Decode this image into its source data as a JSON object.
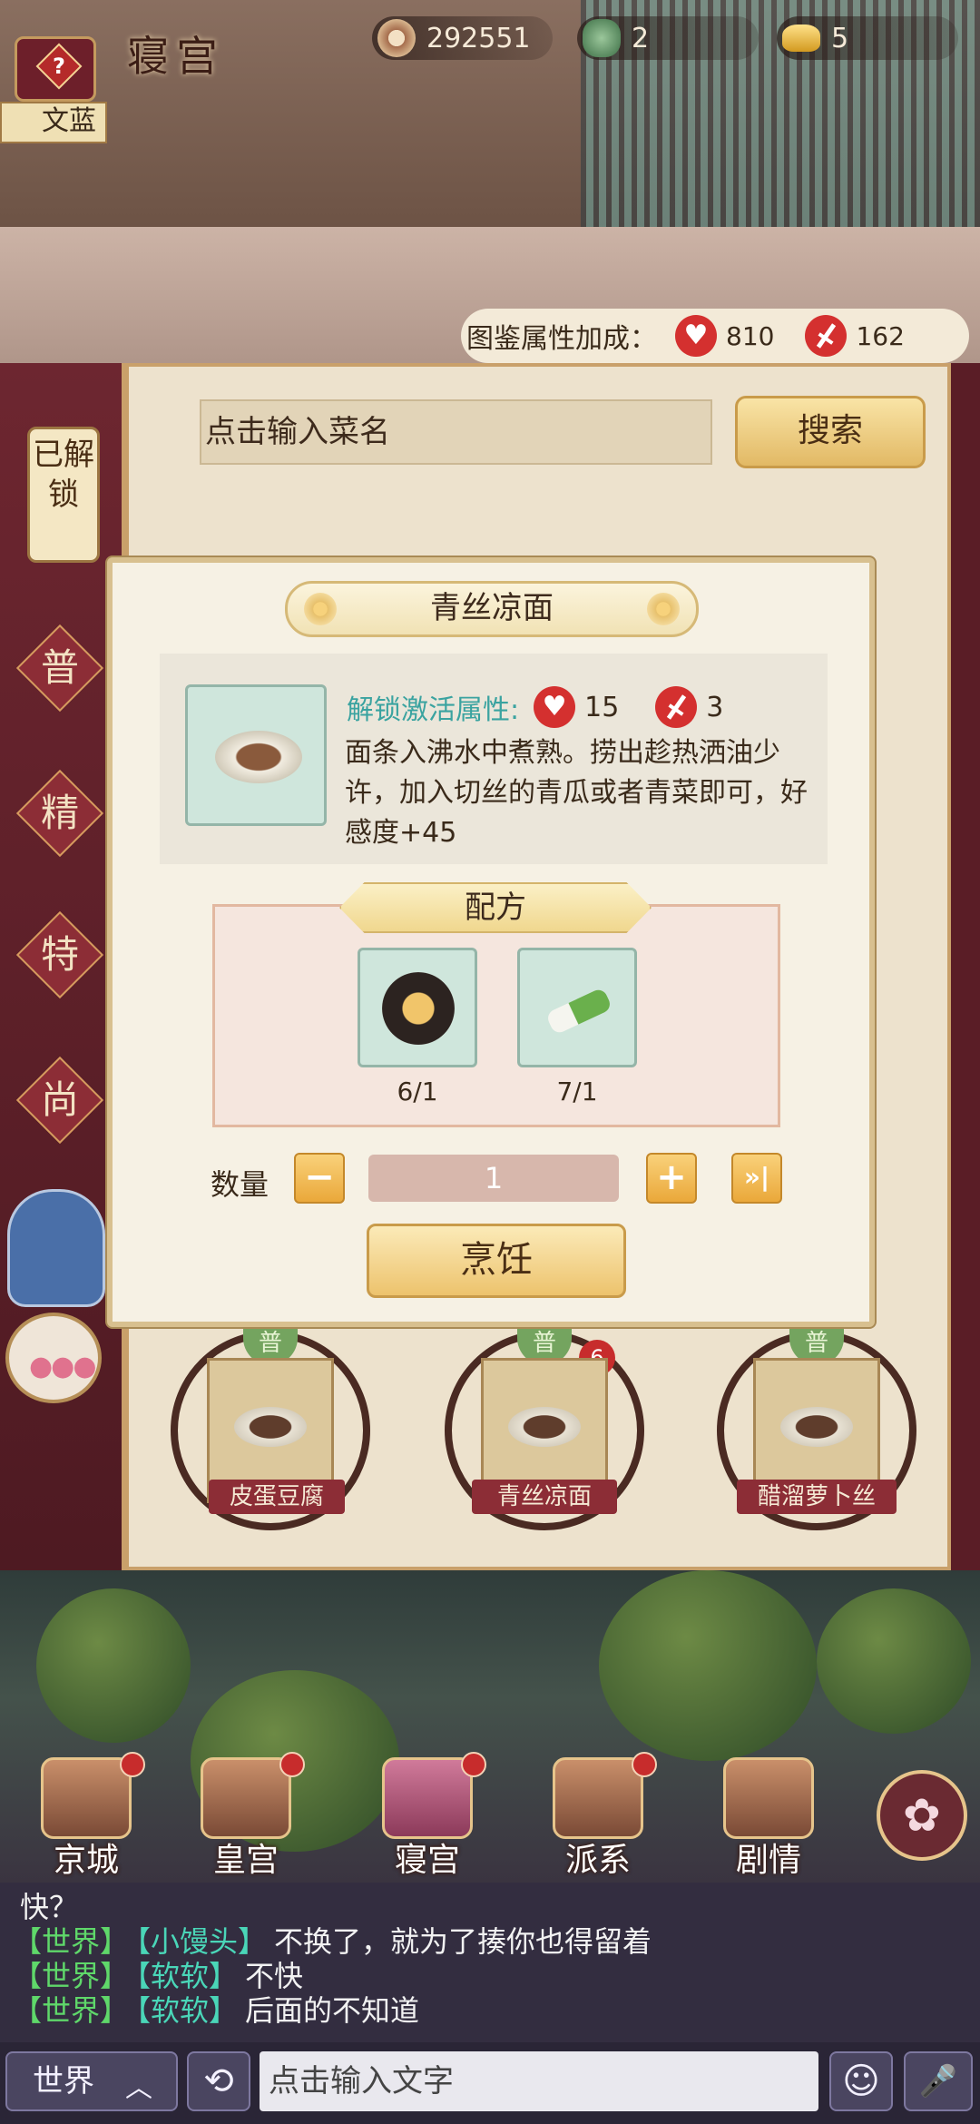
{
  "hud": {
    "room_title": "寝宫",
    "coins": "292551",
    "jade": "2",
    "gold": "5",
    "help_symbol": "?",
    "character_name": "文蓝"
  },
  "bonus": {
    "label": "图鉴属性加成：",
    "charm": "810",
    "power": "162"
  },
  "search": {
    "placeholder": "点击输入菜名",
    "button": "搜索"
  },
  "side_tabs": {
    "unlocked": "已解锁",
    "categories": [
      "普",
      "精",
      "特",
      "尚"
    ]
  },
  "dishes": [
    {
      "tag": "普",
      "name": "皮蛋豆腐",
      "badge": ""
    },
    {
      "tag": "普",
      "name": "青丝凉面",
      "badge": "6"
    },
    {
      "tag": "普",
      "name": "醋溜萝卜丝",
      "badge": ""
    }
  ],
  "modal": {
    "title": "青丝凉面",
    "unlock_label": "解锁激活属性:",
    "charm": "15",
    "power": "3",
    "description": "面条入沸水中煮熟。捞出趁热洒油少许，加入切丝的青瓜或者青菜即可，好感度+45",
    "recipe_title": "配方",
    "ingredients": [
      {
        "icon": "noodle-bowl-icon",
        "count": "6/1"
      },
      {
        "icon": "green-onion-icon",
        "count": "7/1"
      }
    ],
    "quantity_label": "数量",
    "minus": "−",
    "plus": "+",
    "max": "»|",
    "quantity_value": "1",
    "cook_button": "烹饪"
  },
  "bottom_nav": [
    {
      "label": "京城",
      "dot": true
    },
    {
      "label": "皇宫",
      "dot": true
    },
    {
      "label": "寝宫",
      "dot": true,
      "active": true
    },
    {
      "label": "派系",
      "dot": true
    },
    {
      "label": "剧情",
      "dot": false
    }
  ],
  "chat": {
    "lines": [
      {
        "channel": "",
        "name": "",
        "message": "快？"
      },
      {
        "channel": "【世界】",
        "name": "【小馒头】",
        "message": "不换了，就为了揍你也得留着"
      },
      {
        "channel": "【世界】",
        "name": "【软软】",
        "message": "不快"
      },
      {
        "channel": "【世界】",
        "name": "【软软】",
        "message": "后面的不知道"
      }
    ],
    "world_button": "世界",
    "input_placeholder": "点击输入文字"
  },
  "colors": {
    "accent_red": "#8c2d36",
    "panel_cream": "#f6f1e4",
    "gold_button": "#edc36d"
  }
}
